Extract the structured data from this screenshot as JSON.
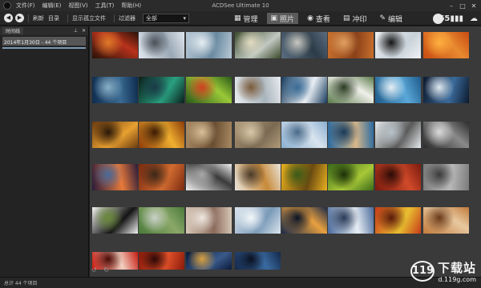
{
  "window": {
    "title": "ACDSee Ultimate 10",
    "controls": [
      "–",
      "□",
      "✕"
    ]
  },
  "menu": [
    {
      "label": "文件(F)"
    },
    {
      "label": "编辑(E)"
    },
    {
      "label": "视图(V)"
    },
    {
      "label": "工具(T)"
    },
    {
      "label": "帮助(H)"
    }
  ],
  "toolbar": {
    "back_icon": "back-arrow-icon",
    "forward_icon": "forward-arrow-icon",
    "refresh_label": "刷新",
    "folder_label": "目录",
    "show_isolated_label": "显示孤立文件",
    "filter_label": "过滤器",
    "filter_value": "全部"
  },
  "modes": [
    {
      "label": "管理",
      "icon": "grid-icon"
    },
    {
      "label": "照片",
      "icon": "photo-icon",
      "active": true
    },
    {
      "label": "查看",
      "icon": "eye-icon"
    },
    {
      "label": "冲印",
      "icon": "develop-icon"
    },
    {
      "label": "编辑",
      "icon": "brush-icon"
    }
  ],
  "right_tools": [
    {
      "icon": "360-icon",
      "text": "365"
    },
    {
      "icon": "bar-chart-icon"
    },
    {
      "icon": "cloud-sync-icon"
    }
  ],
  "side_panel": {
    "tab_label": "时间线",
    "item_label": "2014年1月30日 - 44 个项目"
  },
  "status": {
    "text": "总计 44 个项目"
  },
  "watermark": {
    "logo_text": "119",
    "brand_text": "下载站",
    "domain_text": "d.119g.com"
  },
  "thumbnails": [
    {
      "name": "red-trees",
      "colors": [
        "#2a1208",
        "#b8321c",
        "#e07a2a"
      ]
    },
    {
      "name": "snowy-cabin",
      "colors": [
        "#dfe6ee",
        "#9aa8b5",
        "#4a5058"
      ]
    },
    {
      "name": "frozen-lake",
      "colors": [
        "#b9c9d6",
        "#6a8aa0",
        "#e6edf2"
      ]
    },
    {
      "name": "waterfall",
      "colors": [
        "#3c4a2c",
        "#c0c8c0",
        "#e2dcc2"
      ]
    },
    {
      "name": "coastal-islands",
      "colors": [
        "#5a6c80",
        "#2e3c48",
        "#c8c8c0"
      ]
    },
    {
      "name": "kangaroo",
      "colors": [
        "#c8702e",
        "#8a4018",
        "#e0a060"
      ]
    },
    {
      "name": "penguin-ice",
      "colors": [
        "#f0f2f4",
        "#c8d2da",
        "#141414"
      ]
    },
    {
      "name": "orange-field",
      "colors": [
        "#c84a10",
        "#e88a30",
        "#ffb040"
      ]
    },
    {
      "name": "blue-hills",
      "colors": [
        "#0e2c4e",
        "#3a6a92",
        "#8ab0c8"
      ]
    },
    {
      "name": "aurora",
      "colors": [
        "#0a1e1a",
        "#2aa080",
        "#1a3a48"
      ]
    },
    {
      "name": "green-spiral",
      "colors": [
        "#2a5a18",
        "#9ac838",
        "#d04020"
      ]
    },
    {
      "name": "snow-deer",
      "colors": [
        "#e8ecf0",
        "#a8b4bc",
        "#7a5a3a"
      ]
    },
    {
      "name": "blue-wave",
      "colors": [
        "#163a5c",
        "#e8eef4",
        "#3a6c98"
      ]
    },
    {
      "name": "white-birds",
      "colors": [
        "#5a7a4a",
        "#f0f0ea",
        "#2a3a22"
      ]
    },
    {
      "name": "lagoon",
      "colors": [
        "#1e5a8a",
        "#5aa8d8",
        "#e4eef4"
      ]
    },
    {
      "name": "iceberg",
      "colors": [
        "#0c1a2e",
        "#3a6a9a",
        "#dfe8f0"
      ]
    },
    {
      "name": "butterfly",
      "colors": [
        "#6a3a10",
        "#e8a030",
        "#2a1808"
      ]
    },
    {
      "name": "golden-hall",
      "colors": [
        "#8a3a08",
        "#f0b030",
        "#3a1a04"
      ]
    },
    {
      "name": "stone-arches",
      "colors": [
        "#a88a62",
        "#6a4e32",
        "#d8c09a"
      ]
    },
    {
      "name": "rocky-bay",
      "colors": [
        "#b09a7a",
        "#7a6a52",
        "#d8c8a8"
      ]
    },
    {
      "name": "flock-sky",
      "colors": [
        "#8aaed0",
        "#d8e4ee",
        "#4a6a8a"
      ]
    },
    {
      "name": "canal-city",
      "colors": [
        "#2a6aa0",
        "#d8b88a",
        "#1a3a58"
      ]
    },
    {
      "name": "herd-snow",
      "colors": [
        "#e8ecee",
        "#5a5a5a",
        "#b8c2c8"
      ]
    },
    {
      "name": "mountain-bw",
      "colors": [
        "#2a2a2a",
        "#8a8a8a",
        "#dadada"
      ]
    },
    {
      "name": "sunset-town",
      "colors": [
        "#2a1a3a",
        "#e87a3a",
        "#4a6a9a"
      ]
    },
    {
      "name": "autumn-forest",
      "colors": [
        "#7a2a10",
        "#d06a30",
        "#3a2818"
      ]
    },
    {
      "name": "snow-tracks",
      "colors": [
        "#f0f0f0",
        "#3a3a3a",
        "#a8a8a8"
      ]
    },
    {
      "name": "bird-branch",
      "colors": [
        "#e8e4da",
        "#c88a3a",
        "#4a3a2a"
      ]
    },
    {
      "name": "sunflower",
      "colors": [
        "#e8b020",
        "#6a4a10",
        "#3a5a18"
      ]
    },
    {
      "name": "green-leaves",
      "colors": [
        "#3a6a18",
        "#a8c838",
        "#1a3008"
      ]
    },
    {
      "name": "red-canyon",
      "colors": [
        "#7a1a0e",
        "#d04a2a",
        "#2a0a06"
      ]
    },
    {
      "name": "bridge-grey",
      "colors": [
        "#7a7a7a",
        "#b8b8b8",
        "#3a3a3a"
      ]
    },
    {
      "name": "panda",
      "colors": [
        "#f2f2f2",
        "#141414",
        "#6a8a3a"
      ]
    },
    {
      "name": "green-hills",
      "colors": [
        "#4a7a3a",
        "#8aa868",
        "#c8d0c8"
      ]
    },
    {
      "name": "child-portrait",
      "colors": [
        "#d8c8b8",
        "#8a6a5a",
        "#f0e8e0"
      ]
    },
    {
      "name": "ice-cave",
      "colors": [
        "#dce6ee",
        "#7a9ab8",
        "#f4f8fa"
      ]
    },
    {
      "name": "floating-lanterns",
      "colors": [
        "#1a2a48",
        "#e8a040",
        "#0a1428"
      ]
    },
    {
      "name": "snowy-peaks",
      "colors": [
        "#4a6a9a",
        "#e8eef4",
        "#2a3a58"
      ]
    },
    {
      "name": "festival-crowd",
      "colors": [
        "#c83a1a",
        "#e8c030",
        "#5a1a0a"
      ]
    },
    {
      "name": "food-plates",
      "colors": [
        "#c07a3a",
        "#e8c8a0",
        "#6a3a18"
      ]
    },
    {
      "name": "red-lanterns",
      "colors": [
        "#c81a10",
        "#f0d0c0",
        "#4a0a06"
      ]
    },
    {
      "name": "red-temple",
      "colors": [
        "#8a1a0a",
        "#e0502a",
        "#2a0806"
      ]
    },
    {
      "name": "night-bridge",
      "colors": [
        "#0a1a3a",
        "#3a5a8a",
        "#d8a040"
      ]
    },
    {
      "name": "night-beach",
      "colors": [
        "#14284a",
        "#3a6aa0",
        "#0a1020"
      ]
    }
  ]
}
